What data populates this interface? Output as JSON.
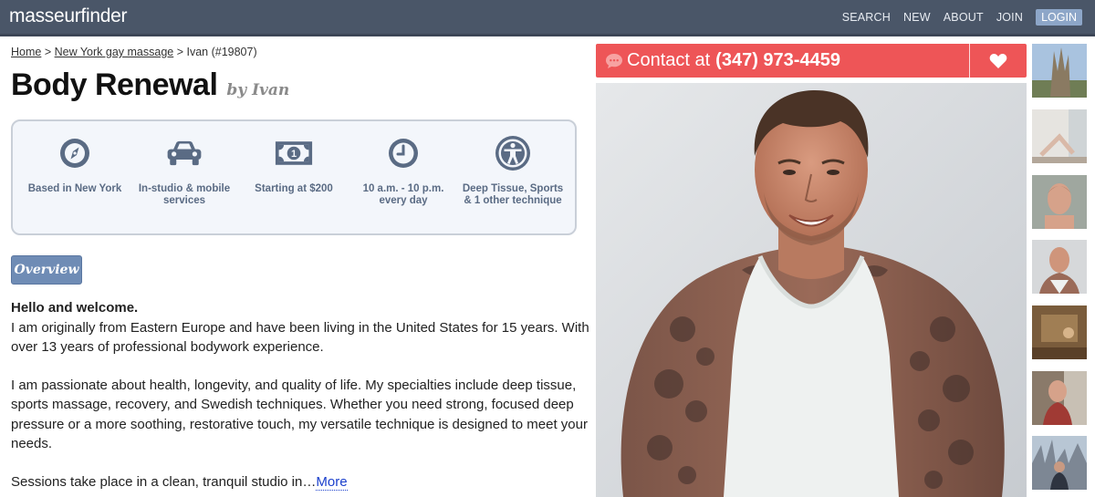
{
  "header": {
    "logo": "masseurfinder",
    "nav": {
      "search": "SEARCH",
      "new": "NEW",
      "about": "ABOUT",
      "join": "JOIN",
      "login": "LOGIN"
    }
  },
  "breadcrumb": {
    "home": "Home",
    "sep1": " > ",
    "city": "New York gay massage",
    "sep2": " > ",
    "current": "Ivan (#19807)"
  },
  "profile": {
    "title": "Body Renewal",
    "byline": "by Ivan"
  },
  "features": [
    {
      "icon": "compass-icon",
      "label": "Based in New York"
    },
    {
      "icon": "car-icon",
      "label": "In-studio & mobile services"
    },
    {
      "icon": "banknote-icon",
      "label": "Starting at $200"
    },
    {
      "icon": "clock-icon",
      "label": "10 a.m. - 10 p.m. every day"
    },
    {
      "icon": "person-circle-icon",
      "label": "Deep Tissue, Sports & 1 other technique"
    }
  ],
  "overview_tab": "Overview",
  "description": {
    "hello": "Hello and welcome.",
    "p1": "I am originally from Eastern Europe and have been living in the United States for 15 years. With over 13 years of professional bodywork experience.",
    "p2": "I am passionate about health, longevity, and quality of life. My specialties include deep tissue, sports massage, recovery, and Swedish techniques. Whether you need strong, focused deep pressure or a more soothing, restorative touch, my versatile technique is designed to meet your needs.",
    "p3": "Sessions take place in a clean, tranquil studio in…",
    "more": "More"
  },
  "contact": {
    "label": "Contact at",
    "phone": "(347) 973-4459",
    "icon": "chat-bubble-icon",
    "favorite_icon": "heart-icon"
  },
  "colors": {
    "topbar": "#4a5668",
    "accent_red": "#ee5557",
    "feature_blue": "#5a6b84",
    "overview_blue": "#6f8cb5",
    "link_blue": "#1a3fcc"
  }
}
